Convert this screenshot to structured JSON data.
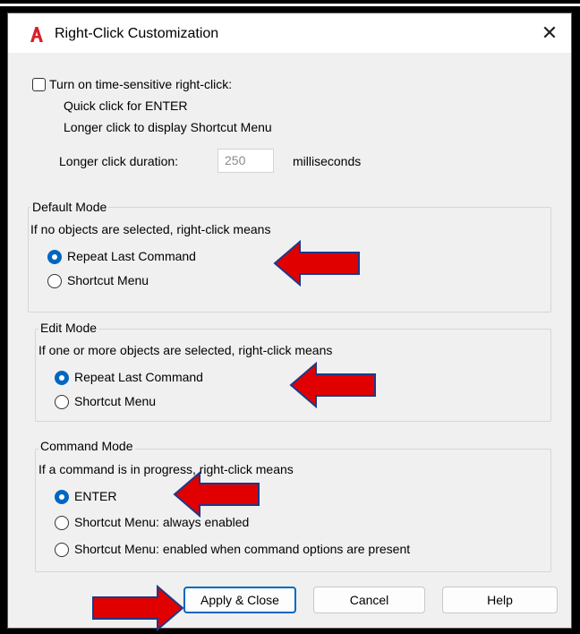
{
  "dialog": {
    "title": "Right-Click Customization",
    "close_glyph": "✕",
    "app_icon": "autocad-a-icon"
  },
  "time_sensitive": {
    "checkbox_label": "Turn on time-sensitive right-click:",
    "checked": false,
    "line1": "Quick click for ENTER",
    "line2": "Longer click to display Shortcut Menu",
    "duration_label": "Longer click duration:",
    "duration_value": "250",
    "duration_unit": "milliseconds"
  },
  "default_mode": {
    "legend": "Default Mode",
    "description": "If no objects are selected, right-click means",
    "options": [
      "Repeat Last Command",
      "Shortcut Menu"
    ],
    "selected": 0
  },
  "edit_mode": {
    "legend": "Edit Mode",
    "description": "If one or more objects are selected, right-click means",
    "options": [
      "Repeat Last Command",
      "Shortcut Menu"
    ],
    "selected": 0
  },
  "command_mode": {
    "legend": "Command Mode",
    "description": "If a command is in progress, right-click means",
    "options": [
      "ENTER",
      "Shortcut Menu: always enabled",
      "Shortcut Menu: enabled when command options are present"
    ],
    "selected": 0
  },
  "buttons": {
    "apply_close": "Apply & Close",
    "cancel": "Cancel",
    "help": "Help"
  },
  "colors": {
    "accent": "#0067c0",
    "annotation_arrow": "#e00000",
    "icon_red": "#d9202a"
  }
}
